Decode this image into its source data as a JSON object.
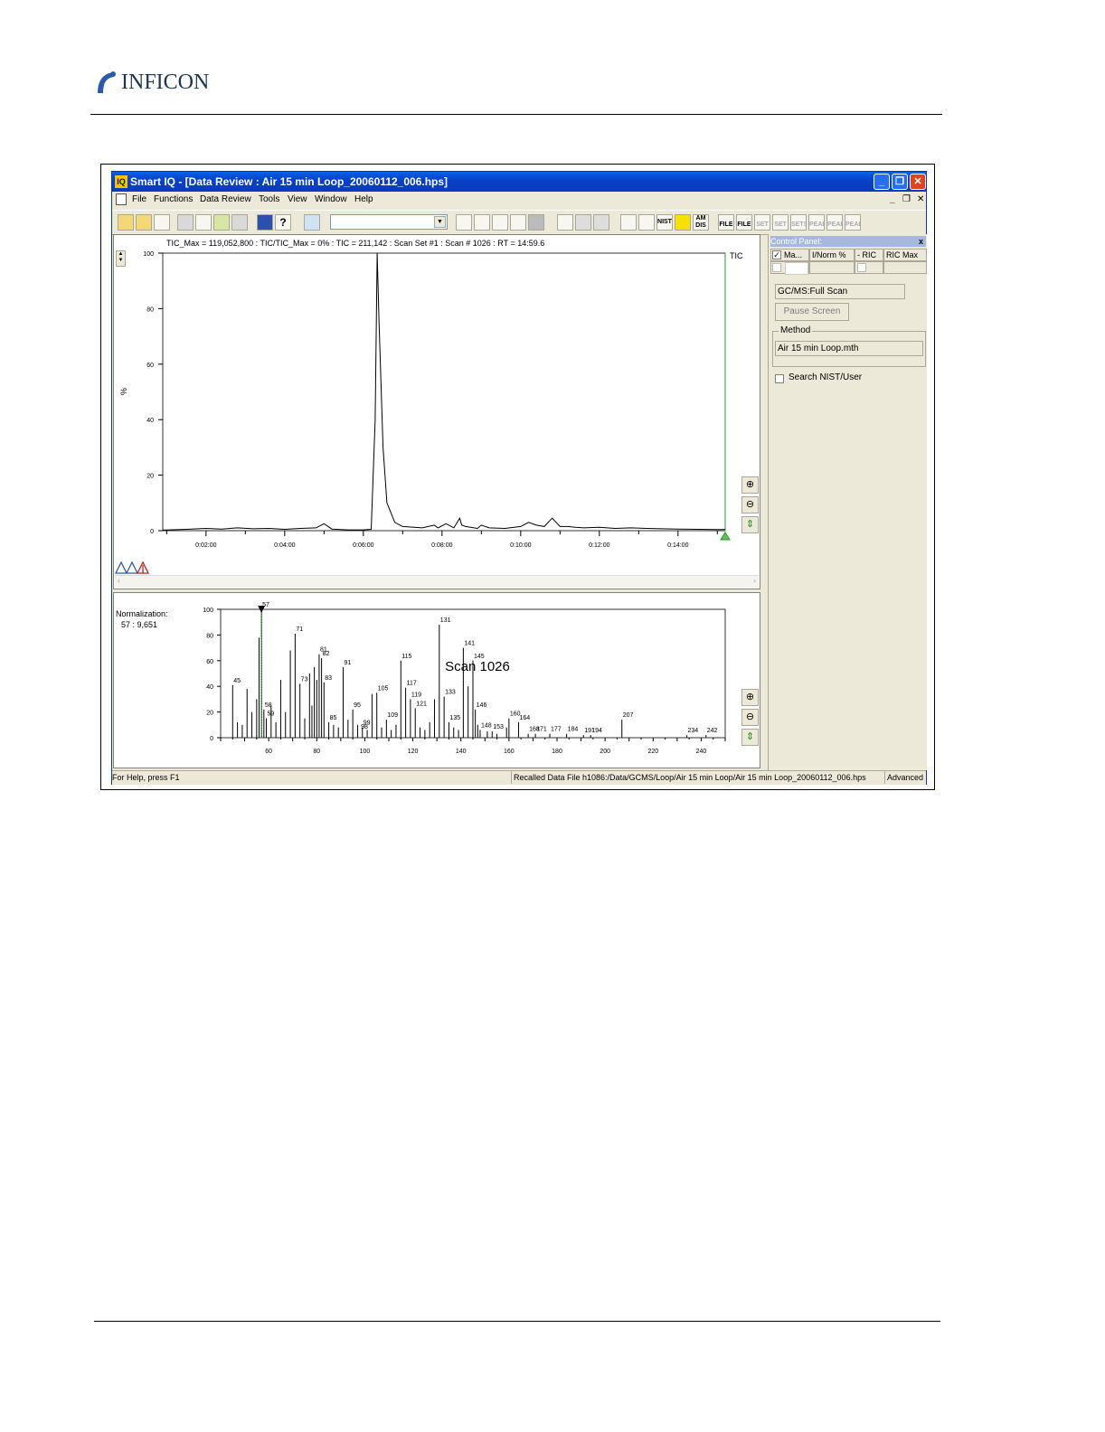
{
  "brand": {
    "name": "INFICON"
  },
  "window": {
    "title": "Smart IQ - [Data Review : Air 15 min Loop_20060112_006.hps]",
    "app_icon": "IQ",
    "controls": {
      "minimize": "_",
      "restore": "❐",
      "close": "✕"
    },
    "mdi_controls": {
      "minimize": "_",
      "restore": "❐",
      "close": "✕"
    }
  },
  "menu": [
    "File",
    "Functions",
    "Data Review",
    "Tools",
    "View",
    "Window",
    "Help"
  ],
  "toolbar": {
    "combo_value": "",
    "labels": {
      "nist": "NIST",
      "am": "AM",
      "dis": "DIS",
      "file1": "FILE",
      "file2": "FILE",
      "set1": "SET",
      "set2": "SET",
      "sets": "SETS",
      "peak1": "PEAK",
      "peak2": "PEAK",
      "peak3": "PEAK"
    }
  },
  "tic": {
    "header": "TIC_Max = 119,052,800 : TIC/TIC_Max = 0% : TIC = 211,142 : Scan Set #1 : Scan #   1026 : RT = 14:59.6",
    "trace_label": "TIC",
    "y_axis_label": "%"
  },
  "spectrum": {
    "normalization_label": "Normalization:",
    "normalization_value": "57 : 9,651",
    "scan_label": "Scan 1026"
  },
  "control_panel": {
    "title": "Control Panel:",
    "close": "x",
    "columns": [
      "Ma...",
      "I/Norm %",
      "- RIC",
      "RIC Max"
    ],
    "mode": "GC/MS:Full Scan",
    "pause_button": "Pause Screen",
    "method_label": "Method",
    "method_value": "Air 15 min Loop.mth",
    "search_label": "Search NIST/User"
  },
  "status": {
    "help": "For Help, press F1",
    "file": "Recalled Data File h1086:/Data/GCMS/Loop/Air 15 min Loop/Air 15 min Loop_20060112_006.hps",
    "mode": "Advanced"
  },
  "colors": {
    "titlebar": "#0842c9",
    "accent_green": "#2a9a2a",
    "close_red": "#e0441c"
  },
  "chart_data": [
    {
      "type": "line",
      "title": "TIC",
      "xlabel": "",
      "ylabel": "%",
      "x_ticks": [
        "0:02:00",
        "0:04:00",
        "0:06:00",
        "0:08:00",
        "0:10:00",
        "0:12:00",
        "0:14:00"
      ],
      "y_ticks": [
        "0",
        "20",
        "40",
        "60",
        "80",
        "100"
      ],
      "xlim_minutes": [
        0.9,
        15.2
      ],
      "ylim": [
        0,
        100
      ],
      "x": [
        0.9,
        1.5,
        2.0,
        2.4,
        2.8,
        3.2,
        3.6,
        4.0,
        4.4,
        4.8,
        5.0,
        5.2,
        5.6,
        6.0,
        6.2,
        6.3,
        6.35,
        6.4,
        6.5,
        6.6,
        6.8,
        7.0,
        7.5,
        7.8,
        7.9,
        8.1,
        8.3,
        8.45,
        8.5,
        8.6,
        8.9,
        9.0,
        9.2,
        9.6,
        10.0,
        10.2,
        10.4,
        10.6,
        10.8,
        11.0,
        11.2,
        11.4,
        11.6,
        12.0,
        12.4,
        12.8,
        13.2,
        13.6,
        14.0,
        14.5,
        15.0,
        15.2
      ],
      "y": [
        0.2,
        0.5,
        0.8,
        0.6,
        1.0,
        0.7,
        0.8,
        0.5,
        0.8,
        1.0,
        2.5,
        0.6,
        0.3,
        0.3,
        0.5,
        40,
        100,
        75,
        30,
        10,
        3,
        1.5,
        1.0,
        2.0,
        1.0,
        2.5,
        1.0,
        4.5,
        2.0,
        1.5,
        0.8,
        2.0,
        1.0,
        0.8,
        1.5,
        3.0,
        2.0,
        1.5,
        4.5,
        1.5,
        1.5,
        1.2,
        1.0,
        1.2,
        0.8,
        1.0,
        0.8,
        0.7,
        0.6,
        0.5,
        0.4,
        0.4
      ]
    },
    {
      "type": "bar",
      "title": "Scan 1026",
      "x_ticks": [
        "60",
        "80",
        "100",
        "120",
        "140",
        "160",
        "180",
        "200",
        "220",
        "240"
      ],
      "y_ticks": [
        "0",
        "20",
        "40",
        "60",
        "80",
        "100"
      ],
      "xlim": [
        40,
        250
      ],
      "ylim": [
        0,
        100
      ],
      "mz": [
        45,
        47,
        49,
        51,
        53,
        55,
        56,
        57,
        58,
        59,
        61,
        63,
        65,
        67,
        69,
        71,
        73,
        75,
        77,
        78,
        79,
        80,
        81,
        82,
        83,
        85,
        87,
        89,
        91,
        93,
        95,
        97,
        99,
        101,
        103,
        105,
        107,
        109,
        111,
        113,
        115,
        117,
        119,
        121,
        123,
        125,
        127,
        129,
        131,
        133,
        135,
        137,
        139,
        141,
        143,
        145,
        146,
        147,
        148,
        151,
        153,
        155,
        159,
        160,
        164,
        168,
        171,
        177,
        184,
        191,
        194,
        207,
        234,
        242
      ],
      "intensity": [
        41,
        12,
        10,
        38,
        20,
        30,
        78,
        100,
        22,
        15,
        25,
        12,
        45,
        20,
        68,
        81,
        42,
        15,
        50,
        25,
        55,
        45,
        65,
        62,
        43,
        12,
        10,
        8,
        55,
        14,
        22,
        10,
        8,
        6,
        34,
        35,
        8,
        14,
        6,
        10,
        60,
        39,
        30,
        23,
        8,
        6,
        12,
        30,
        88,
        32,
        12,
        8,
        6,
        70,
        40,
        60,
        22,
        10,
        6,
        5,
        5,
        3,
        8,
        15,
        12,
        3,
        3,
        3,
        3,
        2,
        2,
        14,
        2,
        2
      ],
      "peak_labels": [
        {
          "mz": 45,
          "label": "45"
        },
        {
          "mz": 57,
          "label": "57"
        },
        {
          "mz": 58,
          "label": "58"
        },
        {
          "mz": 59,
          "label": "59"
        },
        {
          "mz": 71,
          "label": "71"
        },
        {
          "mz": 73,
          "label": "73"
        },
        {
          "mz": 81,
          "label": "81"
        },
        {
          "mz": 82,
          "label": "82"
        },
        {
          "mz": 83,
          "label": "83"
        },
        {
          "mz": 85,
          "label": "85"
        },
        {
          "mz": 91,
          "label": "91"
        },
        {
          "mz": 95,
          "label": "95"
        },
        {
          "mz": 98,
          "label": "98"
        },
        {
          "mz": 99,
          "label": "99"
        },
        {
          "mz": 105,
          "label": "105"
        },
        {
          "mz": 109,
          "label": "109"
        },
        {
          "mz": 115,
          "label": "115"
        },
        {
          "mz": 117,
          "label": "117"
        },
        {
          "mz": 119,
          "label": "119"
        },
        {
          "mz": 121,
          "label": "121"
        },
        {
          "mz": 131,
          "label": "131"
        },
        {
          "mz": 133,
          "label": "133"
        },
        {
          "mz": 135,
          "label": "135"
        },
        {
          "mz": 141,
          "label": "141"
        },
        {
          "mz": 145,
          "label": "145"
        },
        {
          "mz": 146,
          "label": "146"
        },
        {
          "mz": 148,
          "label": "148"
        },
        {
          "mz": 153,
          "label": "153"
        },
        {
          "mz": 160,
          "label": "160"
        },
        {
          "mz": 164,
          "label": "164"
        },
        {
          "mz": 168,
          "label": "168"
        },
        {
          "mz": 171,
          "label": "171"
        },
        {
          "mz": 177,
          "label": "177"
        },
        {
          "mz": 184,
          "label": "184"
        },
        {
          "mz": 191,
          "label": "191"
        },
        {
          "mz": 194,
          "label": "194"
        },
        {
          "mz": 207,
          "label": "207"
        },
        {
          "mz": 234,
          "label": "234"
        },
        {
          "mz": 242,
          "label": "242"
        }
      ]
    }
  ]
}
